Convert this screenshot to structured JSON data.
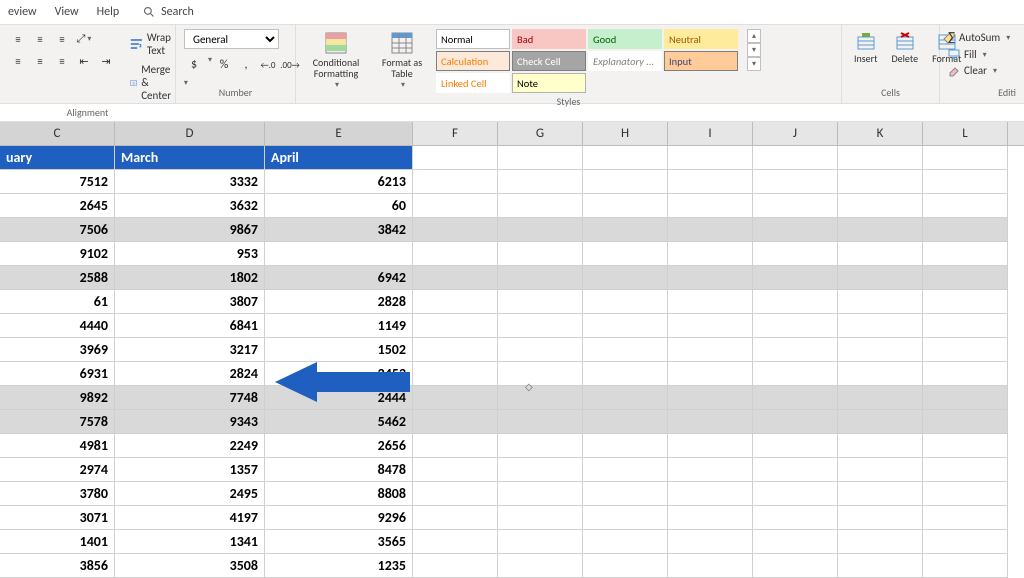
{
  "tabs": {
    "review": "eview",
    "view": "View",
    "help": "Help",
    "search": "Search"
  },
  "alignment": {
    "label": "Alignment",
    "wrap": "Wrap Text",
    "merge": "Merge & Center"
  },
  "number": {
    "label": "Number",
    "format": "General",
    "currency": "$",
    "percent": "%",
    "comma": ",",
    "inc": ".0",
    "dec": ".00"
  },
  "cond": {
    "label": "Conditional Formatting"
  },
  "table": {
    "label": "Format as Table"
  },
  "styles": {
    "label": "Styles",
    "items": [
      {
        "t": "Normal",
        "bg": "#ffffff",
        "fg": "#000",
        "bd": "#bfbfbf"
      },
      {
        "t": "Bad",
        "bg": "#f8c7c4",
        "fg": "#9c0006",
        "bd": "#f8c7c4"
      },
      {
        "t": "Good",
        "bg": "#c6efce",
        "fg": "#006100",
        "bd": "#c6efce"
      },
      {
        "t": "Neutral",
        "bg": "#ffeb9c",
        "fg": "#9c5700",
        "bd": "#ffeb9c"
      },
      {
        "t": "Calculation",
        "bg": "#fde9d9",
        "fg": "#fa7d00",
        "bd": "#7f7f7f"
      },
      {
        "t": "Check Cell",
        "bg": "#a5a5a5",
        "fg": "#ffffff",
        "bd": "#7f7f7f"
      },
      {
        "t": "Explanatory ...",
        "bg": "#ffffff",
        "fg": "#7f7f7f",
        "bd": "#ffffff",
        "it": true
      },
      {
        "t": "Input",
        "bg": "#ffcc99",
        "fg": "#3f3f76",
        "bd": "#7f7f7f"
      },
      {
        "t": "Linked Cell",
        "bg": "#ffffff",
        "fg": "#fa7d00",
        "bd": "#ffffff"
      },
      {
        "t": "Note",
        "bg": "#ffffcc",
        "fg": "#000",
        "bd": "#b2b2b2"
      }
    ]
  },
  "cells": {
    "label": "Cells",
    "insert": "Insert",
    "delete": "Delete",
    "format": "Format"
  },
  "editing": {
    "label": "Editi",
    "autosum": "AutoSum",
    "fill": "Fill",
    "clear": "Clear"
  },
  "columns": [
    "C",
    "D",
    "E",
    "F",
    "G",
    "H",
    "I",
    "J",
    "K",
    "L"
  ],
  "headers": {
    "C": "uary",
    "D": "March",
    "E": "April"
  },
  "chart_data": {
    "type": "table",
    "columns": [
      "C",
      "D",
      "E"
    ],
    "column_labels": [
      "uary",
      "March",
      "April"
    ],
    "rows": [
      {
        "C": 7512,
        "D": 3332,
        "E": 6213,
        "highlight": false
      },
      {
        "C": 2645,
        "D": 3632,
        "E": 60,
        "highlight": false
      },
      {
        "C": 7506,
        "D": 9867,
        "E": 3842,
        "highlight": true
      },
      {
        "C": 9102,
        "D": 953,
        "E": null,
        "highlight": false,
        "active": true
      },
      {
        "C": 2588,
        "D": 1802,
        "E": 6942,
        "highlight": true
      },
      {
        "C": 61,
        "D": 3807,
        "E": 2828,
        "highlight": false
      },
      {
        "C": 4440,
        "D": 6841,
        "E": 1149,
        "highlight": false
      },
      {
        "C": 3969,
        "D": 3217,
        "E": 1502,
        "highlight": false
      },
      {
        "C": 6931,
        "D": 2824,
        "E": 2453,
        "highlight": false
      },
      {
        "C": 9892,
        "D": 7748,
        "E": 2444,
        "highlight": true
      },
      {
        "C": 7578,
        "D": 9343,
        "E": 5462,
        "highlight": true
      },
      {
        "C": 4981,
        "D": 2249,
        "E": 2656,
        "highlight": false
      },
      {
        "C": 2974,
        "D": 1357,
        "E": 8478,
        "highlight": false
      },
      {
        "C": 3780,
        "D": 2495,
        "E": 8808,
        "highlight": false
      },
      {
        "C": 3071,
        "D": 4197,
        "E": 9296,
        "highlight": false
      },
      {
        "C": 1401,
        "D": 1341,
        "E": 3565,
        "highlight": false
      },
      {
        "C": 3856,
        "D": 3508,
        "E": 1235,
        "highlight": false
      }
    ]
  }
}
